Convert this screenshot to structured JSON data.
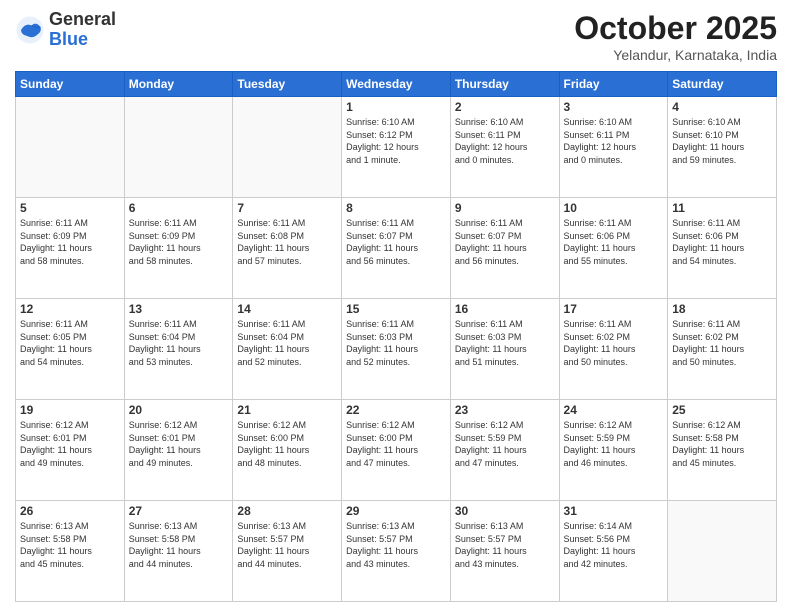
{
  "logo": {
    "general": "General",
    "blue": "Blue"
  },
  "header": {
    "month": "October 2025",
    "location": "Yelandur, Karnataka, India"
  },
  "weekdays": [
    "Sunday",
    "Monday",
    "Tuesday",
    "Wednesday",
    "Thursday",
    "Friday",
    "Saturday"
  ],
  "weeks": [
    [
      {
        "day": "",
        "info": ""
      },
      {
        "day": "",
        "info": ""
      },
      {
        "day": "",
        "info": ""
      },
      {
        "day": "1",
        "info": "Sunrise: 6:10 AM\nSunset: 6:12 PM\nDaylight: 12 hours\nand 1 minute."
      },
      {
        "day": "2",
        "info": "Sunrise: 6:10 AM\nSunset: 6:11 PM\nDaylight: 12 hours\nand 0 minutes."
      },
      {
        "day": "3",
        "info": "Sunrise: 6:10 AM\nSunset: 6:11 PM\nDaylight: 12 hours\nand 0 minutes."
      },
      {
        "day": "4",
        "info": "Sunrise: 6:10 AM\nSunset: 6:10 PM\nDaylight: 11 hours\nand 59 minutes."
      }
    ],
    [
      {
        "day": "5",
        "info": "Sunrise: 6:11 AM\nSunset: 6:09 PM\nDaylight: 11 hours\nand 58 minutes."
      },
      {
        "day": "6",
        "info": "Sunrise: 6:11 AM\nSunset: 6:09 PM\nDaylight: 11 hours\nand 58 minutes."
      },
      {
        "day": "7",
        "info": "Sunrise: 6:11 AM\nSunset: 6:08 PM\nDaylight: 11 hours\nand 57 minutes."
      },
      {
        "day": "8",
        "info": "Sunrise: 6:11 AM\nSunset: 6:07 PM\nDaylight: 11 hours\nand 56 minutes."
      },
      {
        "day": "9",
        "info": "Sunrise: 6:11 AM\nSunset: 6:07 PM\nDaylight: 11 hours\nand 56 minutes."
      },
      {
        "day": "10",
        "info": "Sunrise: 6:11 AM\nSunset: 6:06 PM\nDaylight: 11 hours\nand 55 minutes."
      },
      {
        "day": "11",
        "info": "Sunrise: 6:11 AM\nSunset: 6:06 PM\nDaylight: 11 hours\nand 54 minutes."
      }
    ],
    [
      {
        "day": "12",
        "info": "Sunrise: 6:11 AM\nSunset: 6:05 PM\nDaylight: 11 hours\nand 54 minutes."
      },
      {
        "day": "13",
        "info": "Sunrise: 6:11 AM\nSunset: 6:04 PM\nDaylight: 11 hours\nand 53 minutes."
      },
      {
        "day": "14",
        "info": "Sunrise: 6:11 AM\nSunset: 6:04 PM\nDaylight: 11 hours\nand 52 minutes."
      },
      {
        "day": "15",
        "info": "Sunrise: 6:11 AM\nSunset: 6:03 PM\nDaylight: 11 hours\nand 52 minutes."
      },
      {
        "day": "16",
        "info": "Sunrise: 6:11 AM\nSunset: 6:03 PM\nDaylight: 11 hours\nand 51 minutes."
      },
      {
        "day": "17",
        "info": "Sunrise: 6:11 AM\nSunset: 6:02 PM\nDaylight: 11 hours\nand 50 minutes."
      },
      {
        "day": "18",
        "info": "Sunrise: 6:11 AM\nSunset: 6:02 PM\nDaylight: 11 hours\nand 50 minutes."
      }
    ],
    [
      {
        "day": "19",
        "info": "Sunrise: 6:12 AM\nSunset: 6:01 PM\nDaylight: 11 hours\nand 49 minutes."
      },
      {
        "day": "20",
        "info": "Sunrise: 6:12 AM\nSunset: 6:01 PM\nDaylight: 11 hours\nand 49 minutes."
      },
      {
        "day": "21",
        "info": "Sunrise: 6:12 AM\nSunset: 6:00 PM\nDaylight: 11 hours\nand 48 minutes."
      },
      {
        "day": "22",
        "info": "Sunrise: 6:12 AM\nSunset: 6:00 PM\nDaylight: 11 hours\nand 47 minutes."
      },
      {
        "day": "23",
        "info": "Sunrise: 6:12 AM\nSunset: 5:59 PM\nDaylight: 11 hours\nand 47 minutes."
      },
      {
        "day": "24",
        "info": "Sunrise: 6:12 AM\nSunset: 5:59 PM\nDaylight: 11 hours\nand 46 minutes."
      },
      {
        "day": "25",
        "info": "Sunrise: 6:12 AM\nSunset: 5:58 PM\nDaylight: 11 hours\nand 45 minutes."
      }
    ],
    [
      {
        "day": "26",
        "info": "Sunrise: 6:13 AM\nSunset: 5:58 PM\nDaylight: 11 hours\nand 45 minutes."
      },
      {
        "day": "27",
        "info": "Sunrise: 6:13 AM\nSunset: 5:58 PM\nDaylight: 11 hours\nand 44 minutes."
      },
      {
        "day": "28",
        "info": "Sunrise: 6:13 AM\nSunset: 5:57 PM\nDaylight: 11 hours\nand 44 minutes."
      },
      {
        "day": "29",
        "info": "Sunrise: 6:13 AM\nSunset: 5:57 PM\nDaylight: 11 hours\nand 43 minutes."
      },
      {
        "day": "30",
        "info": "Sunrise: 6:13 AM\nSunset: 5:57 PM\nDaylight: 11 hours\nand 43 minutes."
      },
      {
        "day": "31",
        "info": "Sunrise: 6:14 AM\nSunset: 5:56 PM\nDaylight: 11 hours\nand 42 minutes."
      },
      {
        "day": "",
        "info": ""
      }
    ]
  ]
}
